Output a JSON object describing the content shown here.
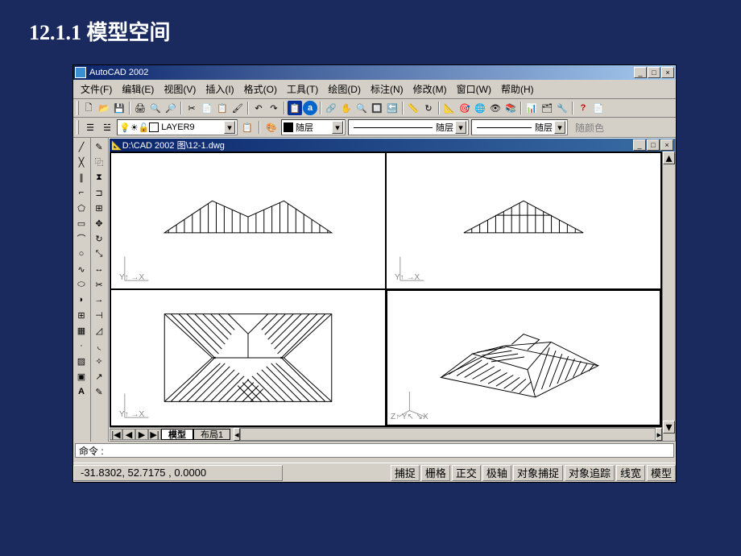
{
  "slide": {
    "heading": "12.1.1  模型空间"
  },
  "window": {
    "title": "AutoCAD 2002",
    "min": "_",
    "max": "□",
    "close": "×"
  },
  "menu": {
    "file": "文件(F)",
    "edit": "编辑(E)",
    "view": "视图(V)",
    "insert": "插入(I)",
    "format": "格式(O)",
    "tools": "工具(T)",
    "draw": "绘图(D)",
    "dim": "标注(N)",
    "modify": "修改(M)",
    "window": "窗口(W)",
    "help": "帮助(H)"
  },
  "layer": {
    "current": "LAYER9",
    "bylayer1": "随层",
    "linetype": "随层",
    "lineweight": "随层",
    "color_label": "随颜色"
  },
  "inner": {
    "title": "D:\\CAD 2002 图\\12-1.dwg",
    "min": "_",
    "max": "□",
    "close": "×"
  },
  "tabs": {
    "model": "模型",
    "layout1": "布局1"
  },
  "command": {
    "prompt": "命令 :"
  },
  "status": {
    "coords": "-31.8302, 52.7175  , 0.0000",
    "snap": "捕捉",
    "grid": "栅格",
    "ortho": "正交",
    "polar": "极轴",
    "osnap": "对象捕捉",
    "otrack": "对象追踪",
    "lwt": "线宽",
    "model": "模型"
  },
  "axis": {
    "x": "X",
    "y": "Y",
    "z": "Z"
  },
  "icons": {
    "new": "🗋",
    "open": "📂",
    "save": "💾",
    "print": "🖨",
    "preview": "🔍",
    "find": "🔎",
    "cut": "✂",
    "copy": "📄",
    "paste": "📋",
    "match": "🖌",
    "undo": "↶",
    "redo": "↷",
    "help": "?",
    "a_blue": "a"
  },
  "tab_nav": {
    "first": "|◀",
    "prev": "◀",
    "next": "▶",
    "last": "▶|"
  },
  "arrow": {
    "down": "▾",
    "up": "▴",
    "left": "◂",
    "right": "▸"
  }
}
